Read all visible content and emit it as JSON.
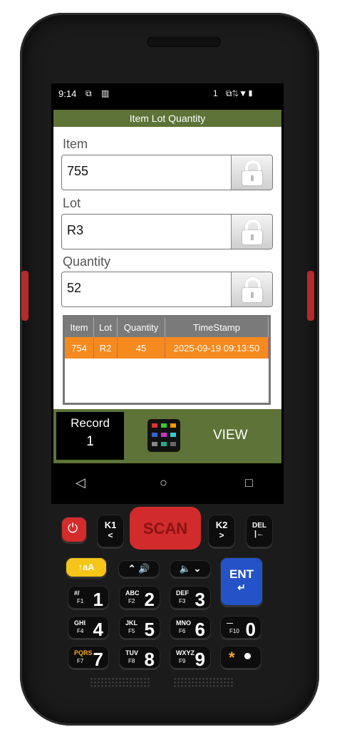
{
  "status_bar": {
    "time": "9:14",
    "notification_count": "1"
  },
  "app": {
    "title": "Item Lot Quantity",
    "fields": [
      {
        "label": "Item",
        "value": "755"
      },
      {
        "label": "Lot",
        "value": "R3"
      },
      {
        "label": "Quantity",
        "value": "52"
      }
    ],
    "table": {
      "headers": [
        "Item",
        "Lot",
        "Quantity",
        "TimeStamp"
      ],
      "rows": [
        [
          "754",
          "R2",
          "45",
          "2025-09-19 09:13:50"
        ]
      ]
    },
    "record_label": "Record",
    "record_value": "1",
    "view_label": "VIEW"
  },
  "navigation": {
    "back": "◁",
    "home": "○",
    "recents": "□"
  },
  "keys": {
    "k1": "K1",
    "k2": "K2",
    "scan": "SCAN",
    "del": "DEL",
    "shift": "↑aA",
    "ent": "ENT",
    "n1": "1",
    "n1s": "#/",
    "n1f": "F1",
    "n2": "2",
    "n2s": "ABC",
    "n2f": "F2",
    "n3": "3",
    "n3s": "DEF",
    "n3f": "F3",
    "n4": "4",
    "n4s": "GHI",
    "n4f": "F4",
    "n5": "5",
    "n5s": "JKL",
    "n5f": "F5",
    "n6": "6",
    "n6s": "MNO",
    "n6f": "F6",
    "n0": "0",
    "n0s": "—",
    "n0f": "F10",
    "n7": "7",
    "n7s": "PQRS",
    "n7f": "F7",
    "n8": "8",
    "n8s": "TUV",
    "n8f": "F8",
    "n9": "9",
    "n9s": "WXYZ",
    "n9f": "F9",
    "star": "*"
  },
  "colors": {
    "app_green": "#5d7337",
    "row_orange": "#f58a1f",
    "scan_red": "#d12b2b",
    "ent_blue": "#2453c8",
    "shift_yellow": "#f5c518"
  }
}
